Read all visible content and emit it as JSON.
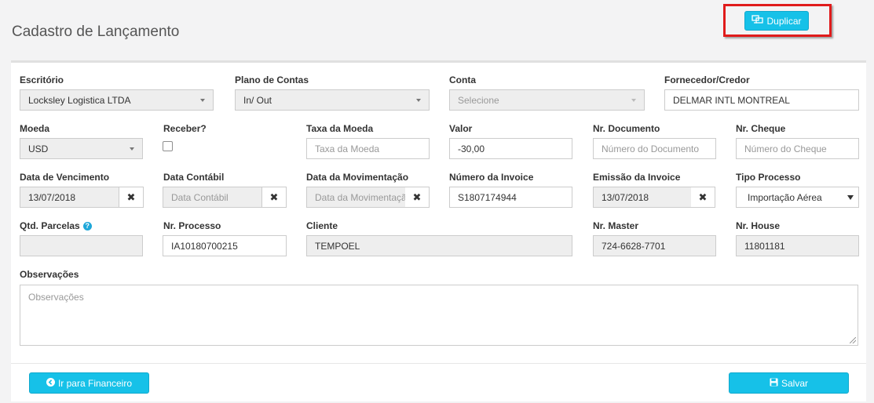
{
  "header": {
    "title": "Cadastro de Lançamento",
    "duplicate_label": "Duplicar"
  },
  "form": {
    "escritorio": {
      "label": "Escritório",
      "value": "Locksley Logistica LTDA"
    },
    "plano_contas": {
      "label": "Plano de Contas",
      "value": "In/ Out"
    },
    "conta": {
      "label": "Conta",
      "value": "Selecione"
    },
    "fornecedor": {
      "label": "Fornecedor/Credor",
      "value": "DELMAR INTL MONTREAL"
    },
    "moeda": {
      "label": "Moeda",
      "value": "USD"
    },
    "receber": {
      "label": "Receber?",
      "checked": false
    },
    "taxa_moeda": {
      "label": "Taxa da Moeda",
      "placeholder": "Taxa da Moeda"
    },
    "valor": {
      "label": "Valor",
      "value": "-30,00"
    },
    "nr_documento": {
      "label": "Nr. Documento",
      "placeholder": "Número do Documento"
    },
    "nr_cheque": {
      "label": "Nr. Cheque",
      "placeholder": "Número do Cheque"
    },
    "data_vencimento": {
      "label": "Data de Vencimento",
      "value": "13/07/2018"
    },
    "data_contabil": {
      "label": "Data Contábil",
      "placeholder": "Data Contábil"
    },
    "data_movimentacao": {
      "label": "Data da Movimentação",
      "placeholder": "Data da Movimentação"
    },
    "numero_invoice": {
      "label": "Número da Invoice",
      "value": "S1807174944"
    },
    "emissao_invoice": {
      "label": "Emissão da Invoice",
      "value": "13/07/2018"
    },
    "tipo_processo": {
      "label": "Tipo Processo",
      "value": "Importação Aérea"
    },
    "qtd_parcelas": {
      "label": "Qtd. Parcelas",
      "value": ""
    },
    "nr_processo": {
      "label": "Nr. Processo",
      "value": "IA10180700215"
    },
    "cliente": {
      "label": "Cliente",
      "value": "TEMPOEL"
    },
    "nr_master": {
      "label": "Nr. Master",
      "value": "724-6628-7701"
    },
    "nr_house": {
      "label": "Nr. House",
      "value": "11801181"
    },
    "observacoes": {
      "label": "Observações",
      "placeholder": "Observações"
    },
    "clear_symbol": "✖"
  },
  "footer": {
    "financeiro_label": "Ir para Financeiro",
    "salvar_label": "Salvar"
  },
  "icons": {
    "duplicate": "duplicate-icon",
    "arrow": "arrow-circle-left-icon",
    "save": "floppy-disk-icon",
    "help": "question-circle-icon"
  },
  "colors": {
    "primary": "#16c1e8",
    "highlight": "#e01b1b"
  }
}
